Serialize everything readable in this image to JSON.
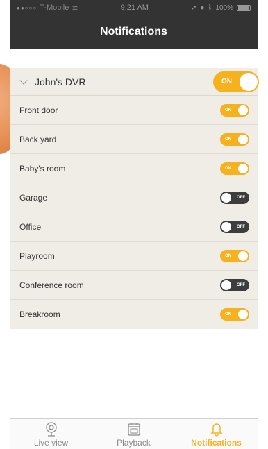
{
  "status_bar": {
    "carrier": "T-Mobile",
    "time": "9:21 AM",
    "battery": "100%"
  },
  "header": {
    "title": "Notifications"
  },
  "dvr": {
    "name": "John's DVR",
    "toggle_label": "ON",
    "state": "on"
  },
  "cameras": [
    {
      "name": "Front door",
      "state": "on",
      "label": "ON"
    },
    {
      "name": "Back yard",
      "state": "on",
      "label": "ON"
    },
    {
      "name": "Baby's room",
      "state": "on",
      "label": "ON"
    },
    {
      "name": "Garage",
      "state": "off",
      "label": "OFF"
    },
    {
      "name": "Office",
      "state": "off",
      "label": "OFF"
    },
    {
      "name": "Playroom",
      "state": "on",
      "label": "ON"
    },
    {
      "name": "Conference room",
      "state": "off",
      "label": "OFF"
    },
    {
      "name": "Breakroom",
      "state": "on",
      "label": "ON"
    }
  ],
  "tabs": [
    {
      "label": "Live view",
      "icon": "webcam-icon",
      "active": false
    },
    {
      "label": "Playback",
      "icon": "calendar-icon",
      "active": false
    },
    {
      "label": "Notifications",
      "icon": "bell-icon",
      "active": true
    }
  ],
  "colors": {
    "accent": "#f6b11e",
    "toggle_off": "#3d3d3d",
    "header_bg": "#333333",
    "list_bg": "#f0ede7"
  }
}
